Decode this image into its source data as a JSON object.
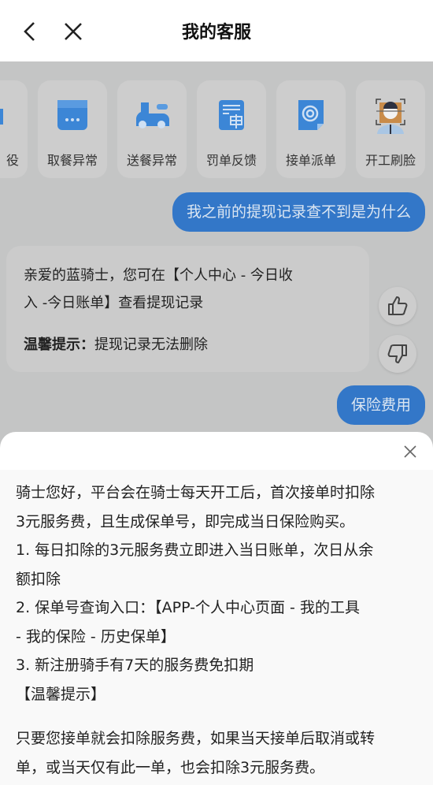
{
  "header": {
    "title": "我的客服",
    "back_icon": "chevron-left-icon",
    "close_icon": "close-icon"
  },
  "quick_cards": [
    {
      "label": "役",
      "icon": "partial-icon"
    },
    {
      "label": "取餐异常",
      "icon": "shop-icon"
    },
    {
      "label": "送餐异常",
      "icon": "scooter-icon"
    },
    {
      "label": "罚单反馈",
      "icon": "appeal-doc-icon"
    },
    {
      "label": "接单派单",
      "icon": "order-dispatch-icon"
    },
    {
      "label": "开工刷脸",
      "icon": "face-scan-icon"
    }
  ],
  "chat": {
    "user_message_1": "我之前的提现记录查不到是为什么",
    "bot_reply": {
      "line1": "亲爱的蓝骑士，您可在【个人中心 - 今日收",
      "line2": "入 -今日账单】查看提现记录",
      "tip_label": "温馨提示：",
      "tip_text": "提现记录无法删除"
    },
    "user_message_2": "保险费用"
  },
  "sheet": {
    "lines": [
      "骑士您好，平台会在骑士每天开工后，首次接单时扣除",
      "3元服务费，且生成保单号，即完成当日保险购买。",
      "1. 每日扣除的3元服务费立即进入当日账单，次日从余",
      "额扣除",
      "2. 保单号查询入口：【APP-个人中心页面 - 我的工具",
      "- 我的保险 - 历史保单】",
      "3. 新注册骑手有7天的服务费免扣期",
      "【温馨提示】"
    ],
    "lines2": [
      "只要您接单就会扣除服务费，如果当天接单后取消或转",
      "单，或当天仅有此一单，也会扣除3元服务费。"
    ]
  },
  "colors": {
    "accent": "#3377c8",
    "overlay": "#c4c5c5"
  }
}
